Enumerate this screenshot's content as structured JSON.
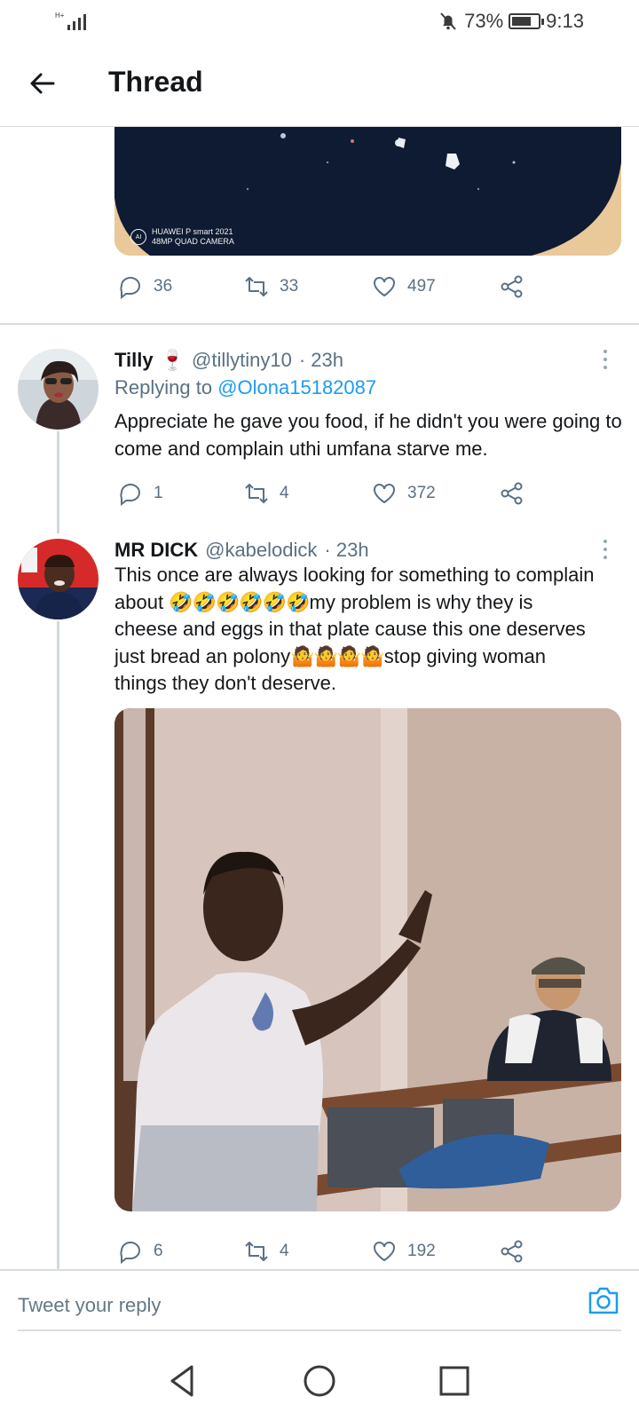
{
  "status_bar": {
    "battery_text": "73%",
    "battery_level": 0.73,
    "time": "9:13",
    "network": "H+"
  },
  "header": {
    "title": "Thread"
  },
  "top_tweet": {
    "image_watermark_line1": "HUAWEI P smart 2021",
    "image_watermark_line2": "48MP QUAD CAMERA",
    "image_watermark_badge": "AI",
    "reply_count": "36",
    "retweet_count": "33",
    "like_count": "497"
  },
  "tweets": [
    {
      "name": "Tilly",
      "name_emoji": "🍷",
      "handle": "@tillytiny10",
      "time": "· 23h",
      "replying_prefix": "Replying to",
      "replying_to": "@Olona15182087",
      "text": "Appreciate he gave you food, if he didn't you were going to come and complain uthi umfana starve me.",
      "reply_count": "1",
      "retweet_count": "4",
      "like_count": "372"
    },
    {
      "name": "MR DICK",
      "handle": "@kabelodick",
      "time": "· 23h",
      "text_line1": "This once are always looking for something to complain",
      "text_line2_a": "about ",
      "text_line2_emoji": "🤣🤣🤣🤣🤣🤣",
      "text_line2_b": "my problem is why they is",
      "text_line3": "cheese and eggs in that plate cause this one deserves",
      "text_line4_a": "just bread an polony",
      "text_line4_emoji": "🤷🤷🤷🤷",
      "text_line4_b": "stop giving woman",
      "text_line5": "things they don't deserve.",
      "reply_count": "6",
      "retweet_count": "4",
      "like_count": "192"
    }
  ],
  "reply_bar": {
    "placeholder": "Tweet your reply"
  },
  "colors": {
    "accent": "#1d9bf0",
    "secondary_text": "#5b7083",
    "divider": "#d9dde0"
  },
  "icons": [
    "back-arrow-icon",
    "mute-bell-icon",
    "battery-icon",
    "more-vertical-icon",
    "reply-icon",
    "retweet-icon",
    "like-icon",
    "share-icon",
    "camera-icon",
    "nav-back-icon",
    "nav-home-icon",
    "nav-recents-icon"
  ]
}
